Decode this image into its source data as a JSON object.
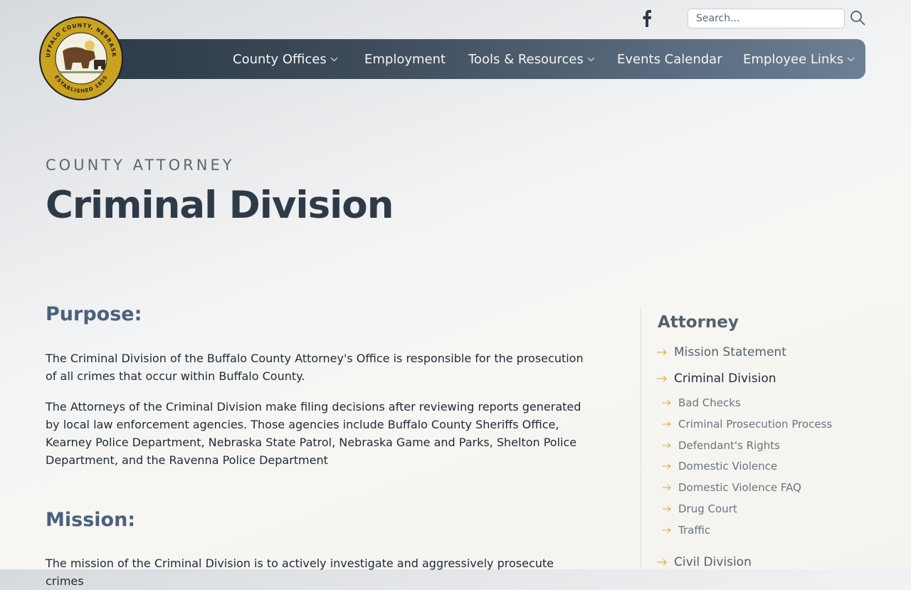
{
  "logo": {
    "ring_text_top": "BUFFALO COUNTY, NEBRASKA",
    "ring_text_bottom": "ESTABLISHED 1855"
  },
  "header": {
    "search_placeholder": "Search..."
  },
  "nav": [
    {
      "label": "County Offices",
      "has_dropdown": true
    },
    {
      "label": "Employment",
      "has_dropdown": false
    },
    {
      "label": "Tools & Resources",
      "has_dropdown": true
    },
    {
      "label": "Events Calendar",
      "has_dropdown": false
    },
    {
      "label": "Employee Links",
      "has_dropdown": true
    }
  ],
  "page": {
    "eyebrow": "COUNTY ATTORNEY",
    "title": "Criminal Division"
  },
  "content": {
    "purpose_heading": "Purpose:",
    "purpose_p1": "The Criminal Division of the Buffalo County Attorney's Office is responsible for the prosecution of all crimes that occur within Buffalo County.",
    "purpose_p2": "The Attorneys of the Criminal Division make filing decisions after reviewing reports generated by local law enforcement agencies. Those agencies include Buffalo County Sheriffs Office, Kearney Police Department, Nebraska State Patrol, Nebraska Game and Parks, Shelton Police Department, and the Ravenna Police Department",
    "mission_heading": "Mission:",
    "mission_p1": "The mission of the Criminal Division is to actively investigate and aggressively prosecute crimes"
  },
  "sidebar": {
    "title": "Attorney",
    "items": [
      {
        "label": "Mission Statement",
        "level": 1
      },
      {
        "label": "Criminal Division",
        "level": 1,
        "active": true
      },
      {
        "label": "Bad Checks",
        "level": 2
      },
      {
        "label": "Criminal Prosecution Process",
        "level": 2
      },
      {
        "label": "Defendant's Rights",
        "level": 2
      },
      {
        "label": "Domestic Violence",
        "level": 2
      },
      {
        "label": "Domestic Violence FAQ",
        "level": 2
      },
      {
        "label": "Drug Court",
        "level": 2
      },
      {
        "label": "Traffic",
        "level": 2
      },
      {
        "label": "Civil Division",
        "level": 1
      }
    ]
  },
  "colors": {
    "nav_dark": "#2d3a47",
    "heading_blue": "#4b607a",
    "arrow_gold": "#d8a83a",
    "seal_gold": "#c9a21f"
  }
}
